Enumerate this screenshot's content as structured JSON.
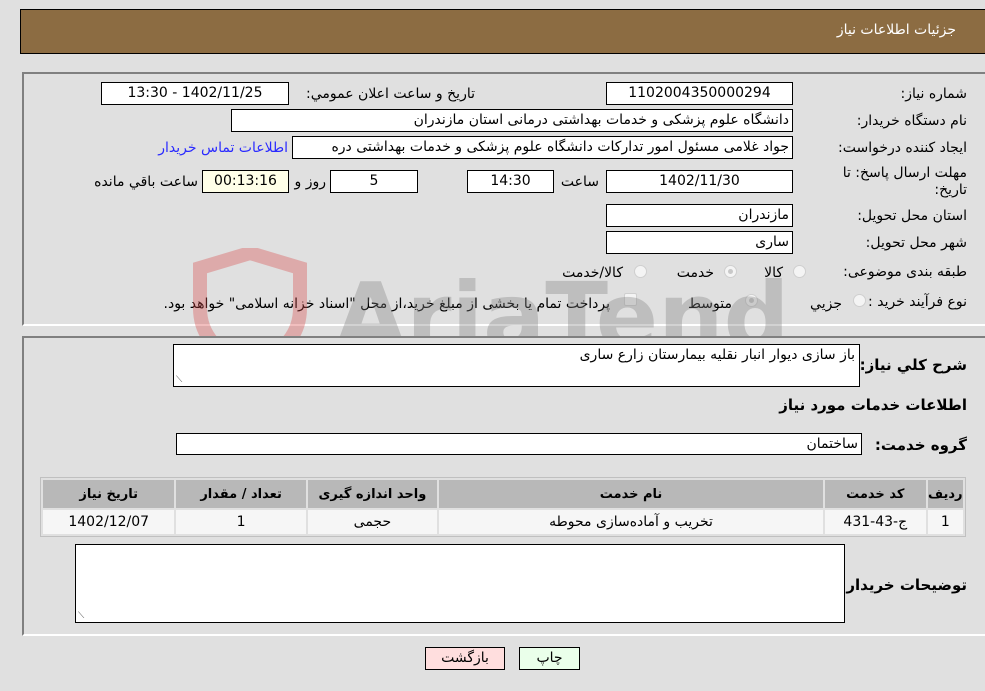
{
  "header": {
    "title": "جزئیات اطلاعات نیاز"
  },
  "fields": {
    "need_number": {
      "label": "شماره نیاز:",
      "value": "1102004350000294"
    },
    "announce_datetime": {
      "label": "تاریخ و ساعت اعلان عمومي:",
      "value": "1402/11/25 - 13:30"
    },
    "buyer_org": {
      "label": "نام دستگاه خریدار:",
      "value": "دانشگاه علوم پزشکی و خدمات بهداشتی  درمانی استان مازندران"
    },
    "requester": {
      "label": "ایجاد کننده درخواست:",
      "value": "جواد غلامی مسئول امور تدارکات دانشگاه علوم پزشکی و خدمات بهداشتی  دره"
    },
    "buyer_contact_link": "اطلاعات تماس خریدار",
    "deadline": {
      "label": "مهلت ارسال پاسخ: تا تاریخ:",
      "date": "1402/11/30",
      "time_label": "ساعت",
      "time": "14:30",
      "days": "5",
      "days_label": "روز و",
      "remaining": "00:13:16",
      "remaining_label": "ساعت باقي مانده"
    },
    "province": {
      "label": "استان محل تحویل:",
      "value": "مازندران"
    },
    "city": {
      "label": "شهر محل تحویل:",
      "value": "ساری"
    },
    "category": {
      "label": "طبقه بندی موضوعی:",
      "options": [
        "کالا",
        "خدمت",
        "کالا/خدمت"
      ],
      "selected": "خدمت"
    },
    "purchase_type": {
      "label": "نوع فرآیند خرید :",
      "options": [
        "جزيي",
        "متوسط"
      ],
      "selected": "متوسط",
      "treasury_note": "پرداخت تمام یا بخشی از مبلغ خرید،از محل \"اسناد خزانه اسلامی\" خواهد بود."
    }
  },
  "description": {
    "label": "شرح كلي نياز:",
    "value": "باز سازی دیوار انبار نقلیه بیمارستان زارع ساری"
  },
  "services_section": {
    "title": "اطلاعات خدمات مورد نیاز",
    "group_label": "گروه خدمت:",
    "group_value": "ساختمان",
    "table": {
      "headers": [
        "ردیف",
        "کد خدمت",
        "نام خدمت",
        "واحد اندازه گیری",
        "تعداد / مقدار",
        "تاریخ نیاز"
      ],
      "rows": [
        [
          "1",
          "ج-43-431",
          "تخریب و آماده‌سازی محوطه",
          "حجمی",
          "1",
          "1402/12/07"
        ]
      ]
    }
  },
  "buyer_notes": {
    "label": "توضیحات خریدار:",
    "value": ""
  },
  "buttons": {
    "print": "چاپ",
    "back": "بازگشت"
  },
  "watermark": {
    "text": "AriaTender.neT"
  },
  "colors": {
    "header_bg": "#8c6c42",
    "print_bg": "#eaffea",
    "back_bg": "#ffdede",
    "link": "#2a2aff"
  }
}
